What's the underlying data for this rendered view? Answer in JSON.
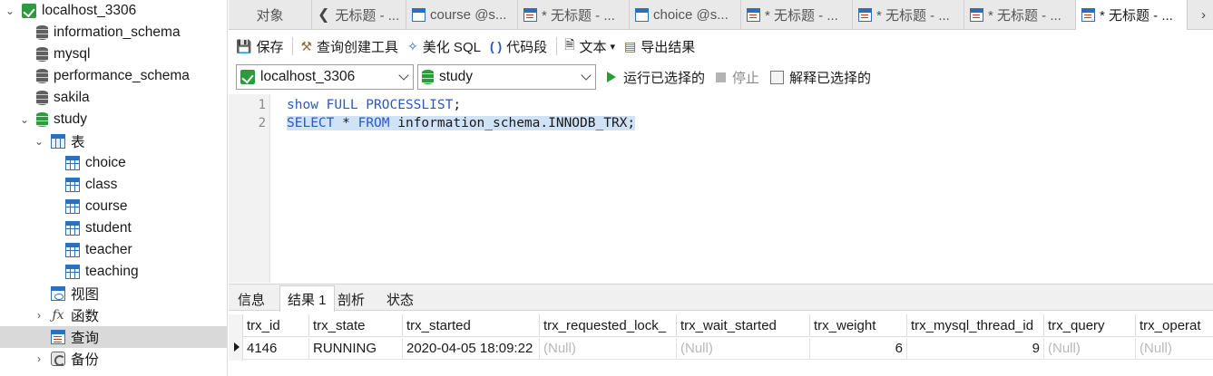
{
  "navigator": {
    "items": [
      {
        "label": "localhost_3306",
        "icon": "connection-icon",
        "chevron": "open",
        "indent": 0
      },
      {
        "label": "information_schema",
        "icon": "database-icon",
        "chevron": "",
        "indent": 1
      },
      {
        "label": "mysql",
        "icon": "database-icon",
        "chevron": "",
        "indent": 1
      },
      {
        "label": "performance_schema",
        "icon": "database-icon",
        "chevron": "",
        "indent": 1
      },
      {
        "label": "sakila",
        "icon": "database-icon",
        "chevron": "",
        "indent": 1
      },
      {
        "label": "study",
        "icon": "database-open-icon",
        "chevron": "open",
        "indent": 1
      },
      {
        "label": "表",
        "icon": "tables-icon",
        "chevron": "open",
        "indent": 2
      },
      {
        "label": "choice",
        "icon": "table-icon",
        "chevron": "",
        "indent": 3
      },
      {
        "label": "class",
        "icon": "table-icon",
        "chevron": "",
        "indent": 3
      },
      {
        "label": "course",
        "icon": "table-icon",
        "chevron": "",
        "indent": 3
      },
      {
        "label": "student",
        "icon": "table-icon",
        "chevron": "",
        "indent": 3
      },
      {
        "label": "teacher",
        "icon": "table-icon",
        "chevron": "",
        "indent": 3
      },
      {
        "label": "teaching",
        "icon": "table-icon",
        "chevron": "",
        "indent": 3
      },
      {
        "label": "视图",
        "icon": "view-icon",
        "chevron": "",
        "indent": 2
      },
      {
        "label": "函数",
        "icon": "function-icon",
        "chevron": "closed",
        "indent": 2
      },
      {
        "label": "查询",
        "icon": "query-icon",
        "chevron": "",
        "indent": 2,
        "selected": true
      },
      {
        "label": "备份",
        "icon": "backup-icon",
        "chevron": "closed",
        "indent": 2
      }
    ]
  },
  "tabs": [
    {
      "label": "对象",
      "icon": "",
      "active": false
    },
    {
      "label": "无标题 - ...",
      "icon": "back-arrow-icon",
      "active": false
    },
    {
      "label": "course @s...",
      "icon": "table-icon",
      "active": false
    },
    {
      "label": "* 无标题 - ...",
      "icon": "query-icon",
      "active": false
    },
    {
      "label": "choice @s...",
      "icon": "table-icon",
      "active": false
    },
    {
      "label": "* 无标题 - ...",
      "icon": "query-icon",
      "active": false
    },
    {
      "label": "* 无标题 - ...",
      "icon": "query-icon",
      "active": false
    },
    {
      "label": "* 无标题 - ...",
      "icon": "query-icon",
      "active": false
    },
    {
      "label": "* 无标题 - ...",
      "icon": "query-icon",
      "active": true
    }
  ],
  "tab_nav_right": "›",
  "toolbar": {
    "save": "保存",
    "query_builder": "查询创建工具",
    "beautify": "美化 SQL",
    "snippet": "代码段",
    "text": "文本",
    "text_caret": "▾",
    "export": "导出结果"
  },
  "connbar": {
    "connection": "localhost_3306",
    "database": "study",
    "run": "运行已选择的",
    "stop": "停止",
    "explain": "解释已选择的"
  },
  "editor": {
    "lines": [
      {
        "number": "1",
        "parts": [
          [
            "kw",
            "show FULL PROCESSLIST"
          ],
          [
            "ident",
            ";"
          ]
        ],
        "selected": false
      },
      {
        "number": "2",
        "parts": [
          [
            "kw",
            "SELECT"
          ],
          [
            "ident",
            " * "
          ],
          [
            "kw",
            "FROM"
          ],
          [
            "ident",
            " information_schema.INNODB_TRX;"
          ]
        ],
        "selected": true
      }
    ]
  },
  "result_tabs": [
    "信息",
    "结果 1",
    "剖析",
    "状态"
  ],
  "active_result_tab": 1,
  "grid": {
    "columns": [
      "trx_id",
      "trx_state",
      "trx_started",
      "trx_requested_lock_",
      "trx_wait_started",
      "trx_weight",
      "trx_mysql_thread_id",
      "trx_query",
      "trx_operat"
    ],
    "rows": [
      [
        "4146",
        "RUNNING",
        "2020-04-05 18:09:22",
        "(Null)",
        "(Null)",
        "6",
        "9",
        "(Null)",
        "(Null)"
      ]
    ]
  },
  "colors": {
    "keyword": "#2a59c4",
    "selection": "#cfe2f6",
    "run_green": "#21a038",
    "null_text": "#b8b8b8"
  }
}
